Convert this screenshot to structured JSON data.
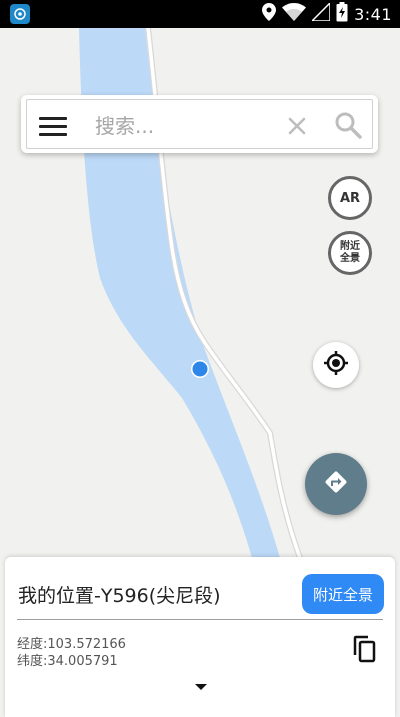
{
  "status_bar": {
    "time": "3:41",
    "icons": [
      "app-icon",
      "location-icon",
      "wifi-icon",
      "signal-icon",
      "battery-icon"
    ]
  },
  "search": {
    "placeholder": "搜索...",
    "value": "",
    "icons": [
      "menu-icon",
      "clear-icon",
      "search-icon"
    ]
  },
  "map_controls": {
    "ar_label": "AR",
    "pano_label_line1": "附近",
    "pano_label_line2": "全景",
    "locate_icon": "my-location-icon",
    "route_icon": "directions-icon",
    "route_color": "#607d8b"
  },
  "map": {
    "river_color": "#bcd9f7",
    "land_color": "#f1f1ef",
    "location_dot_color": "#2e86e8"
  },
  "info_card": {
    "title": "我的位置-Y596(尖尼段)",
    "nearby_button": "附近全景",
    "longitude_text": "经度:103.572166",
    "latitude_text": "纬度:34.005791",
    "accent_color": "#2f8af5",
    "icons": [
      "copy-icon",
      "expand-more-icon"
    ]
  }
}
